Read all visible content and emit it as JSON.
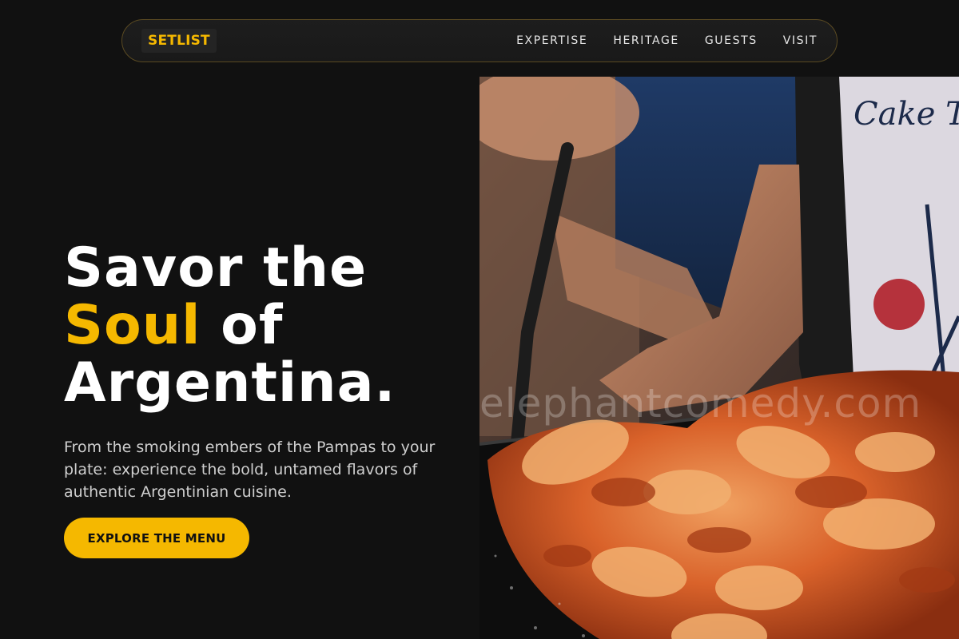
{
  "nav": {
    "logo": "SETLIST",
    "links": [
      "EXPERTISE",
      "HERITAGE",
      "GUESTS",
      "VISIT"
    ]
  },
  "hero": {
    "title_line1": "Savor the",
    "title_accent": "Soul",
    "title_line2_rest": " of",
    "title_line3": "Argentina.",
    "description": "From the smoking embers of the Pampas to your plate: experience the bold, untamed flavors of authentic Argentinian cuisine.",
    "cta_label": "EXPLORE THE MENU"
  },
  "photo": {
    "watermark": "elephantcomedy.com",
    "apron_text": "Cake Tour Paris"
  },
  "colors": {
    "accent": "#f5b800",
    "background": "#111111",
    "nav_border": "#5a4a22"
  }
}
